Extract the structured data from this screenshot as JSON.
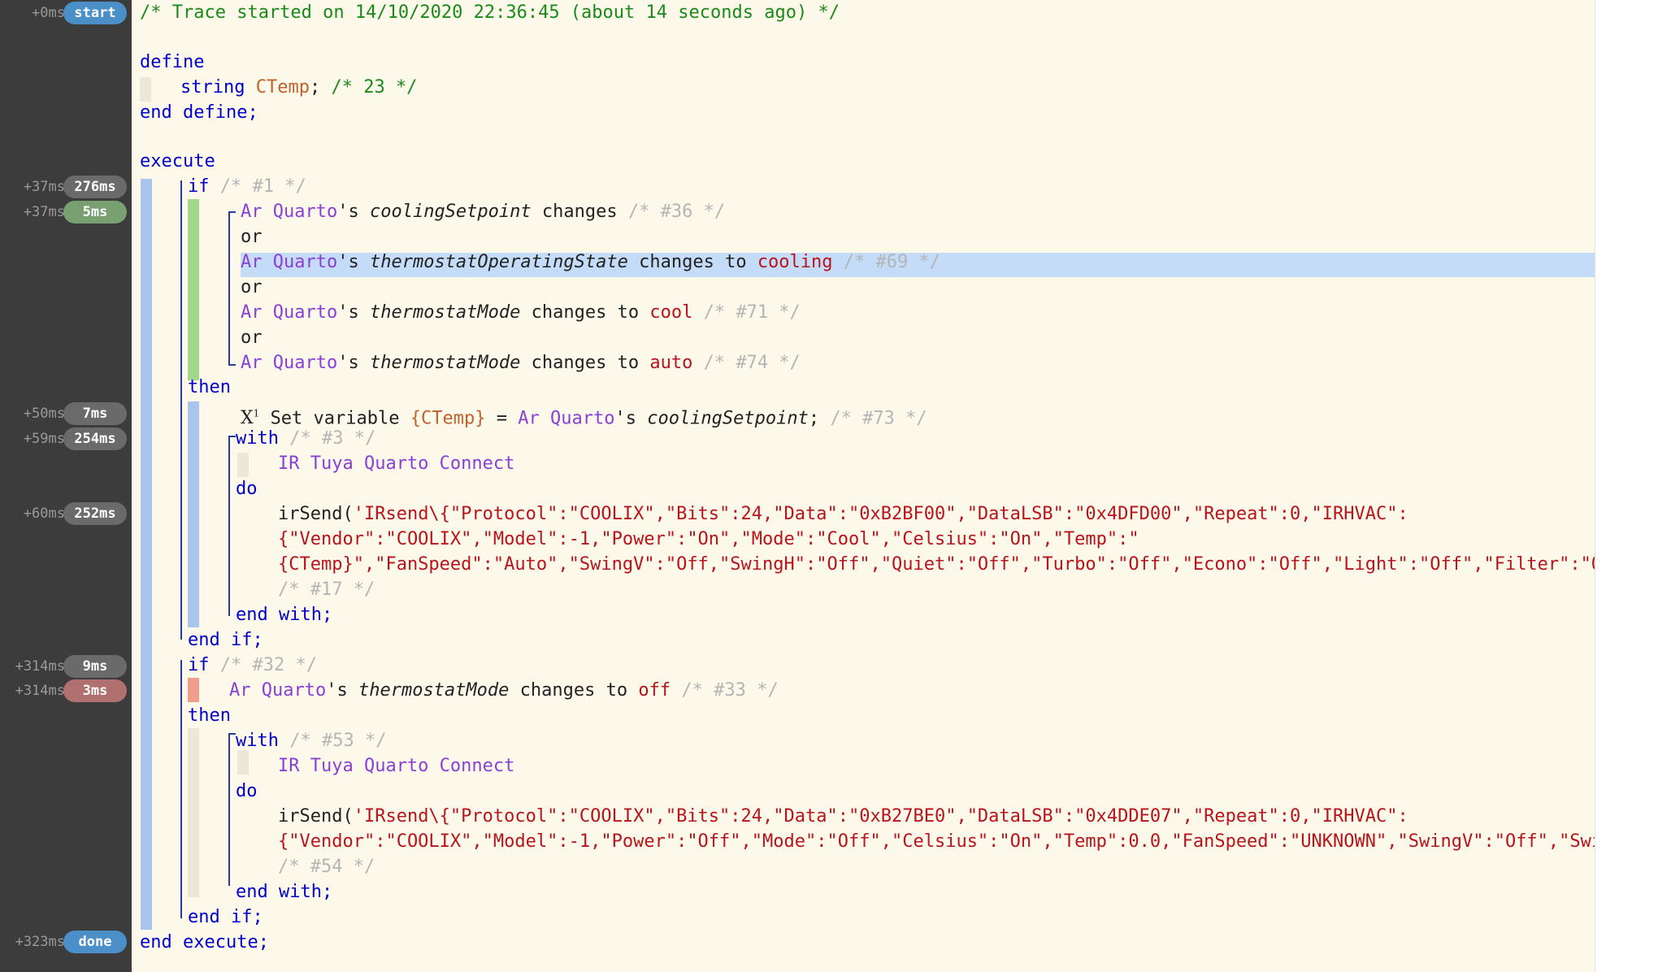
{
  "gutter": [
    {
      "ts": "+0ms",
      "badge": "start",
      "color": "blue"
    },
    {
      "ts": "+37ms",
      "badge": "276ms",
      "color": "gray"
    },
    {
      "ts": "+37ms",
      "badge": "5ms",
      "color": "green"
    },
    {
      "ts": "+50ms",
      "badge": "7ms",
      "color": "gray"
    },
    {
      "ts": "+59ms",
      "badge": "254ms",
      "color": "gray"
    },
    {
      "ts": "+60ms",
      "badge": "252ms",
      "color": "gray"
    },
    {
      "ts": "+314ms",
      "badge": "9ms",
      "color": "gray"
    },
    {
      "ts": "+314ms",
      "badge": "3ms",
      "color": "red"
    },
    {
      "ts": "+323ms",
      "badge": "done",
      "color": "blue"
    }
  ],
  "code": {
    "header_comment": "/* Trace started on 14/10/2020 22:36:45 (about 14 seconds ago) */",
    "kw_define": "define",
    "kw_string": "string",
    "var_ctemp": "CTemp",
    "define_comment": "/* 23 */",
    "kw_end_define": "end define;",
    "kw_execute": "execute",
    "kw_if": "if",
    "kw_or": "or",
    "kw_then": "then",
    "kw_with": "with",
    "kw_do": "do",
    "kw_end_with": "end with;",
    "kw_end_if": "end if;",
    "kw_end_execute": "end execute;",
    "kw_changes": "changes",
    "kw_changes_to": "changes to",
    "possessive": "'s",
    "device": "Ar Quarto",
    "device_ir": "IR Tuya Quarto Connect",
    "attr_cooling_setpoint": "coolingSetpoint",
    "attr_op_state": "thermostatOperatingState",
    "attr_mode": "thermostatMode",
    "val_cooling": "cooling",
    "val_cool": "cool",
    "val_auto": "auto",
    "val_off": "off",
    "c1": "/* #1 */",
    "c36": "/* #36 */",
    "c69": "/* #69 */",
    "c71": "/* #71 */",
    "c74": "/* #74 */",
    "c73": "/* #73 */",
    "c3": "/* #3 */",
    "c17": "/* #17 */",
    "c32": "/* #32 */",
    "c33": "/* #33 */",
    "c53": "/* #53 */",
    "c54": "/* #54 */",
    "set_icon": "X",
    "set_icon_sup": "1",
    "set_variable": "Set variable",
    "set_var_ref": "{CTemp}",
    "equals": "=",
    "semicolon": ";",
    "fn_irsend": "irSend(",
    "irsend1_l1": "'IRsend\\{\"Protocol\":\"COOLIX\",\"Bits\":24,\"Data\":\"0xB2BF00\",\"DataLSB\":\"0x4DFD00\",\"Repeat\":0,\"IRHVAC\":",
    "irsend1_l2": "{\"Vendor\":\"COOLIX\",\"Model\":-1,\"Power\":\"On\",\"Mode\":\"Cool\",\"Celsius\":\"On\",\"Temp\":\"",
    "irsend1_l3": "{CTemp}\",\"FanSpeed\":\"Auto\",\"SwingV\":\"Off,\"SwingH\":\"Off\",\"Quiet\":\"Off\",\"Turbo\":\"Off\",\"Econo\":\"Off\",\"Light\":\"Off\",\"Filter\":\"Off",
    "irsend2_l1": "'IRsend\\{\"Protocol\":\"COOLIX\",\"Bits\":24,\"Data\":\"0xB27BE0\",\"DataLSB\":\"0x4DDE07\",\"Repeat\":0,\"IRHVAC\":",
    "irsend2_l2": "{\"Vendor\":\"COOLIX\",\"Model\":-1,\"Power\":\"Off\",\"Mode\":\"Off\",\"Celsius\":\"On\",\"Temp\":0.0,\"FanSpeed\":\"UNKNOWN\",\"SwingV\":\"Off\",\"Swing"
  },
  "colors": {
    "gutter_bg": "#3c3c3c",
    "code_bg": "#fcf9ea",
    "keyword": "#0000cc",
    "device": "#8a3fd6",
    "value": "#b8141c",
    "variable": "#c0622d",
    "comment": "#1b8a1b",
    "trace_blue": "#a9c5ef",
    "trace_green": "#a3d88a",
    "trace_red": "#f29c8e",
    "highlight": "#c4dcf7"
  }
}
